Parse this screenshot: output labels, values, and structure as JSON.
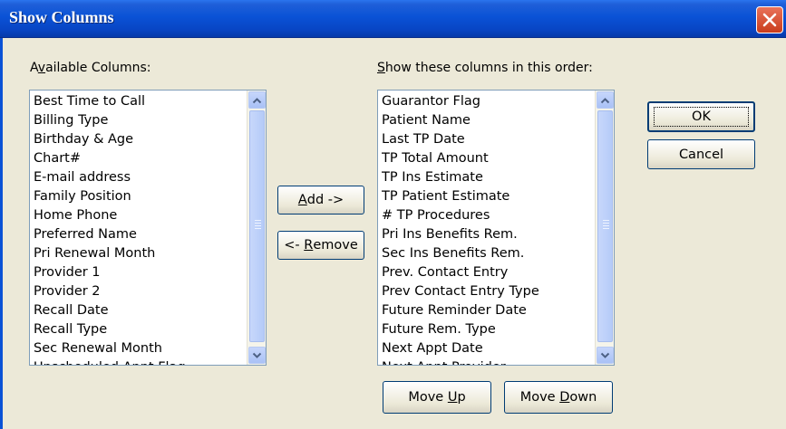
{
  "window": {
    "title": "Show Columns"
  },
  "available": {
    "label_pre": "A",
    "label_accel": "v",
    "label_post": "ailable Columns:",
    "items": [
      "Best Time to Call",
      "Billing Type",
      "Birthday & Age",
      "Chart#",
      "E-mail address",
      "Family Position",
      "Home Phone",
      "Preferred Name",
      "Pri Renewal Month",
      "Provider 1",
      "Provider 2",
      "Recall Date",
      "Recall Type",
      "Sec Renewal Month",
      "Unscheduled Appt Flag"
    ]
  },
  "shown": {
    "label_accel": "S",
    "label_post": "how these columns in this order:",
    "items": [
      "Guarantor Flag",
      "Patient Name",
      "Last TP Date",
      "TP Total Amount",
      "TP Ins Estimate",
      "TP Patient Estimate",
      "# TP Procedures",
      "Pri Ins Benefits Rem.",
      "Sec Ins Benefits Rem.",
      "Prev. Contact Entry",
      "Prev Contact Entry Type",
      "Future Reminder Date",
      "Future Rem. Type",
      "Next Appt Date",
      "Next Appt Provider"
    ]
  },
  "buttons": {
    "add_accel": "A",
    "add_post": "dd ->",
    "remove_pre": "<- ",
    "remove_accel": "R",
    "remove_post": "emove",
    "ok_label": "OK",
    "cancel_label": "Cancel",
    "move_up_pre": "Move ",
    "move_up_accel": "U",
    "move_up_post": "p",
    "move_down_pre": "Move ",
    "move_down_accel": "D",
    "move_down_post": "own"
  },
  "icons": {
    "close": "close-icon",
    "scroll_up": "chevron-up-icon",
    "scroll_down": "chevron-down-icon"
  }
}
